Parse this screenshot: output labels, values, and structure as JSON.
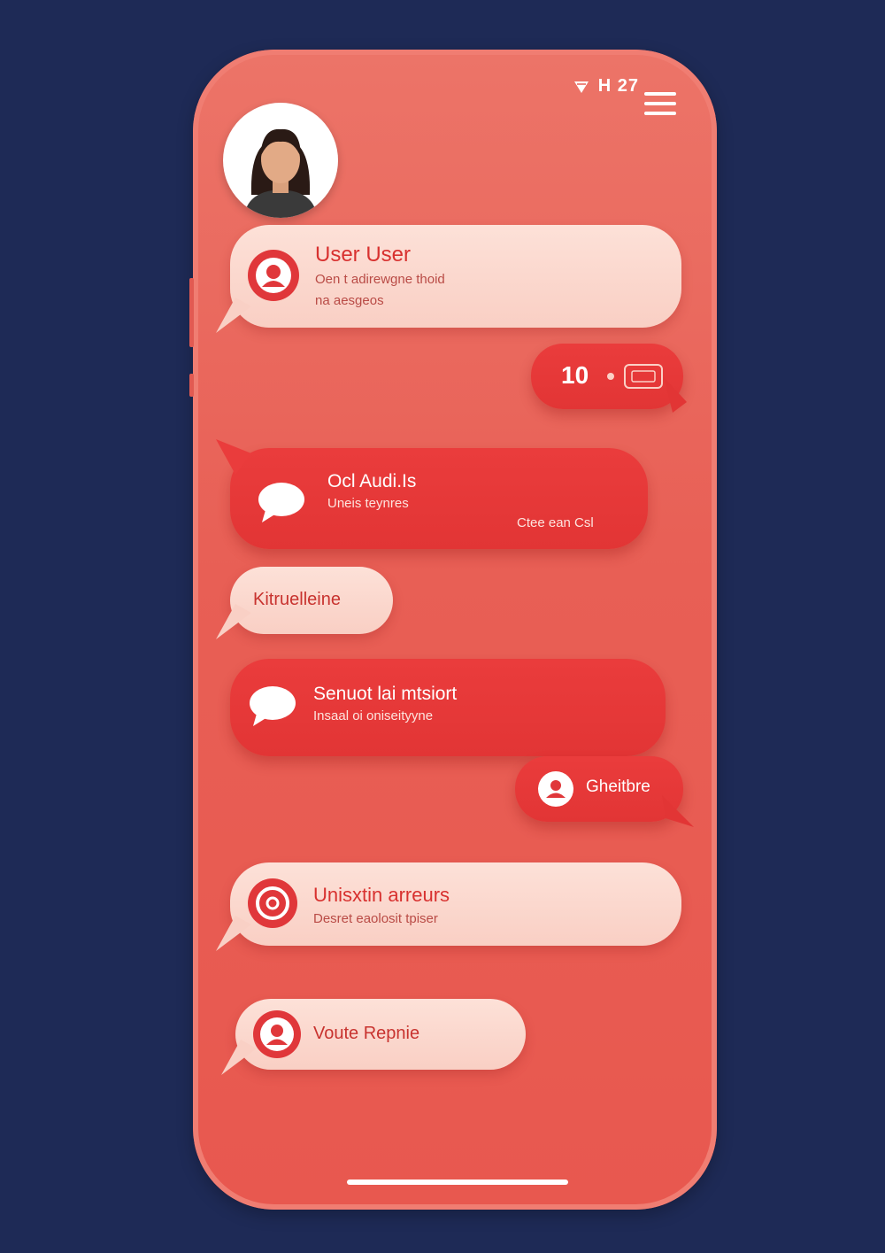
{
  "status_bar": {
    "time": "H 27"
  },
  "messages": [
    {
      "title": "User User",
      "subtitle": "Oen t adirewgne thoid\nna aesgeos",
      "icon": "user-icon"
    },
    {
      "value": "10",
      "icon": "ticket-icon"
    },
    {
      "title": "Ocl Audi.Is",
      "subtitle": "Uneis teynres",
      "meta": "Ctee ean Csl",
      "icon": "chat-bubble-icon"
    },
    {
      "title": "Kitruelleine"
    },
    {
      "title": "Senuot lai mtsiort",
      "subtitle": "Insaal oi oniseityyne",
      "icon": "chat-bubble-icon"
    },
    {
      "title": "Gheitbre",
      "icon": "user-icon"
    },
    {
      "title": "Unisxtin arreurs",
      "subtitle": "Desret eaolosit tpiser",
      "icon": "at-sign-icon"
    },
    {
      "title": "Voute Repnie",
      "icon": "user-icon"
    }
  ],
  "colors": {
    "background": "#1e2a56",
    "phone": "#e85f55",
    "accent": "#e0373a",
    "light_bubble": "#fbd7ce"
  }
}
